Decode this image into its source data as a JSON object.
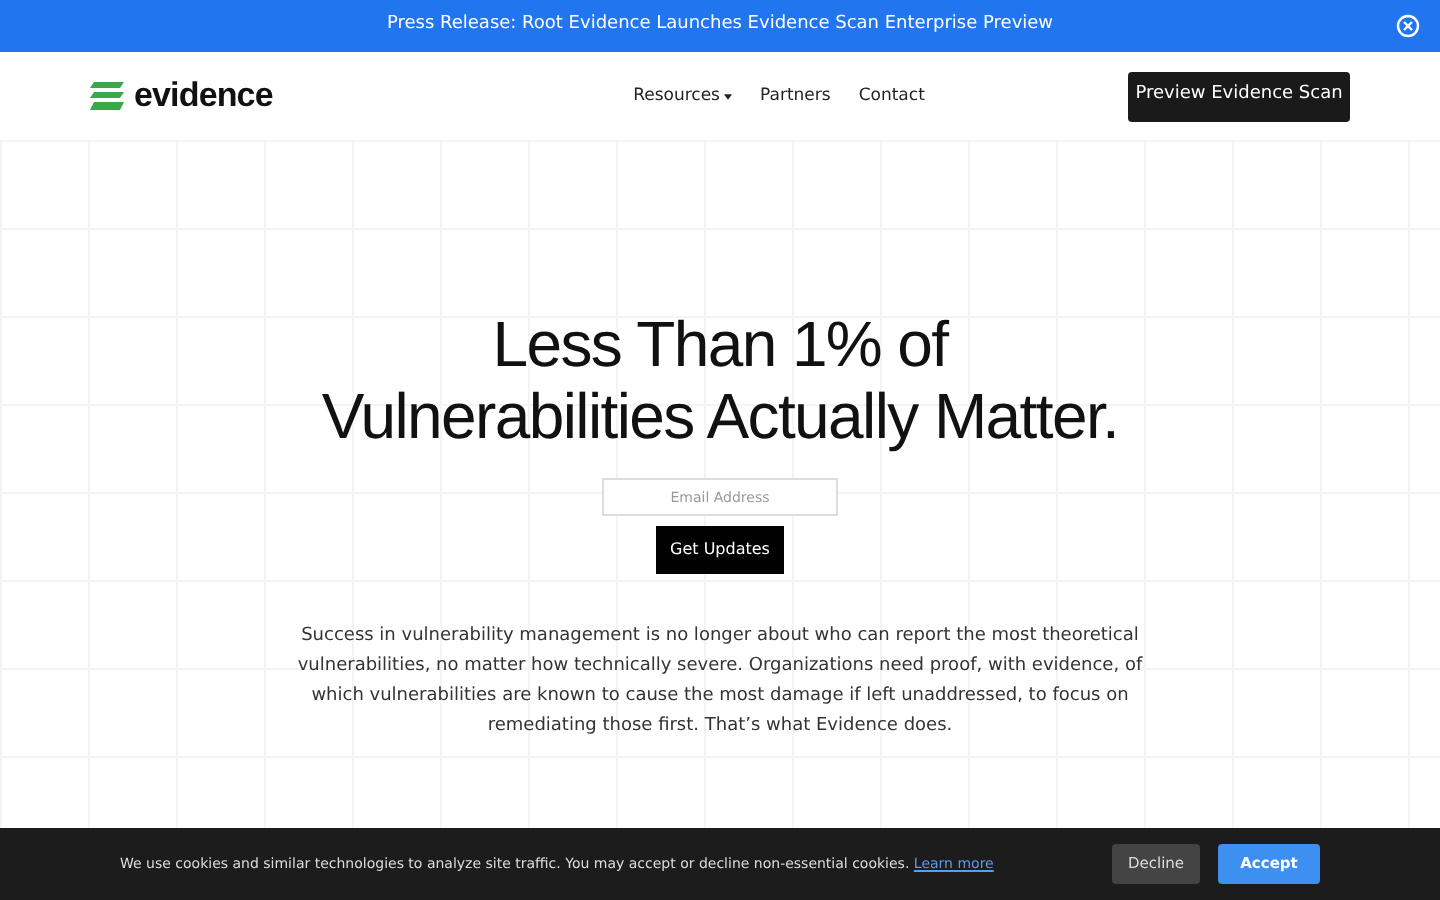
{
  "banner": {
    "text": "Press Release: Root Evidence Launches Evidence Scan Enterprise Preview"
  },
  "nav": {
    "logo": "evidence",
    "links": [
      {
        "label": "Resources",
        "dropdown": true
      },
      {
        "label": "Partners",
        "dropdown": false
      },
      {
        "label": "Contact",
        "dropdown": false
      }
    ],
    "cta": "Preview Evidence Scan"
  },
  "hero": {
    "title_lines": [
      "Less Than 1% of",
      "Vulnerabilities Actually Matter."
    ],
    "email": {
      "placeholder": "Email Address"
    },
    "button": "Get Updates",
    "body": "Success in vulnerability management is no longer about who can report the most theoretical vulnerabilities, no matter how technically severe. Organizations need proof, with evidence, of which vulnerabilities are known to cause the most damage if left unaddressed, to focus on remediating those first. That’s what Evidence does."
  },
  "cookie_bar": {
    "text": "We use cookies and similar technologies to analyze site traffic. You may accept or decline non-essential cookies.",
    "link": "Learn more",
    "buttons": [
      {
        "label": "Decline",
        "kind": "secondary"
      },
      {
        "label": "Accept",
        "kind": "primary"
      }
    ]
  }
}
